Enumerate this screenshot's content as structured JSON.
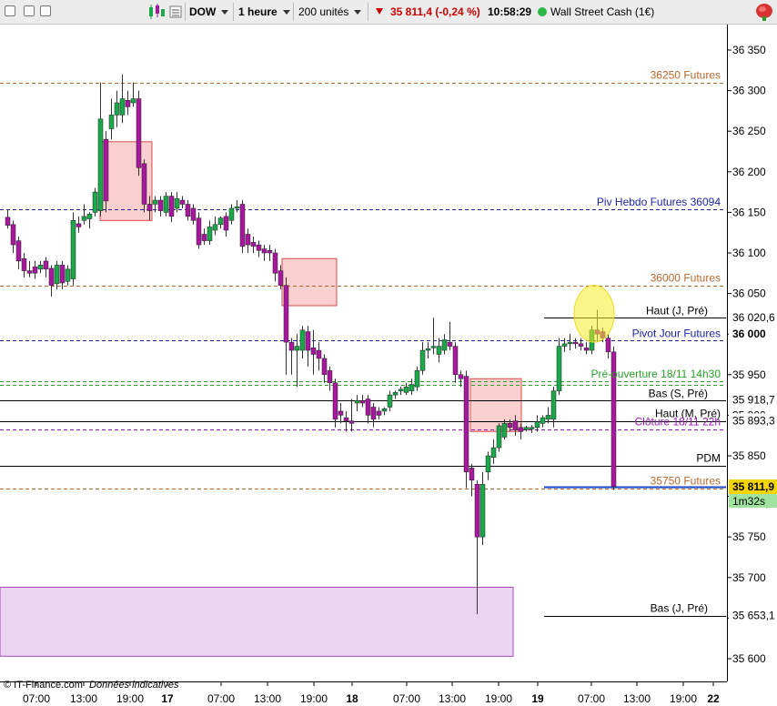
{
  "toolbar": {
    "symbol": "DOW",
    "timeframe": "1 heure",
    "units": "200 unités",
    "price": "35 811,4 (-0,24 %)",
    "time": "10:58:29",
    "instrument": "Wall Street Cash (1€)",
    "icons": [
      "window-icon",
      "window-icon",
      "window-icon",
      "candles-icon",
      "menu-icon",
      "tree-icon"
    ]
  },
  "footer": {
    "credit": "© IT-Finance.com",
    "note": "Données indicatives"
  },
  "colors": {
    "up": "#1aa84a",
    "down": "#a8189e",
    "futures": "#b8682c",
    "pivot": "#1c24a0",
    "preopen": "#28a028",
    "close": "#9a1ab8",
    "last_bg": "#f5d400",
    "timer_bg": "#9fe39f"
  },
  "chart_data": {
    "type": "candlestick",
    "y_ticks": [
      "36 350",
      "36 300",
      "36 250",
      "36 200",
      "36 150",
      "36 100",
      "36 050",
      "36 000",
      "35 950",
      "35 900",
      "35 850",
      "35 800",
      "35 750",
      "35 700",
      "35 650",
      "35 600"
    ],
    "ylim": [
      35585,
      36375
    ],
    "x_ticks": [
      {
        "label": "07:00",
        "x": 40
      },
      {
        "label": "13:00",
        "x": 92
      },
      {
        "label": "19:00",
        "x": 143
      },
      {
        "label": "17",
        "x": 184,
        "bold": true
      },
      {
        "label": "07:00",
        "x": 243
      },
      {
        "label": "13:00",
        "x": 294
      },
      {
        "label": "19:00",
        "x": 345
      },
      {
        "label": "18",
        "x": 387,
        "bold": true
      },
      {
        "label": "07:00",
        "x": 447
      },
      {
        "label": "13:00",
        "x": 497
      },
      {
        "label": "19:00",
        "x": 548
      },
      {
        "label": "19",
        "x": 591,
        "bold": true
      },
      {
        "label": "07:00",
        "x": 650
      },
      {
        "label": "13:00",
        "x": 700
      },
      {
        "label": "19:00",
        "x": 751
      },
      {
        "label": "22",
        "x": 784,
        "bold": true
      }
    ],
    "candles": [
      {
        "x": 8,
        "o": 36144,
        "h": 36153,
        "c": 36134,
        "l": 36130
      },
      {
        "x": 14,
        "o": 36135,
        "h": 36140,
        "c": 36110,
        "l": 36100
      },
      {
        "x": 20,
        "o": 36115,
        "h": 36120,
        "c": 36090,
        "l": 36080
      },
      {
        "x": 26,
        "o": 36093,
        "h": 36100,
        "c": 36078,
        "l": 36070
      },
      {
        "x": 32,
        "o": 36078,
        "h": 36090,
        "c": 36075,
        "l": 36070
      },
      {
        "x": 38,
        "o": 36083,
        "h": 36090,
        "c": 36075,
        "l": 36068
      },
      {
        "x": 44,
        "o": 36080,
        "h": 36090,
        "c": 36085,
        "l": 36075
      },
      {
        "x": 50,
        "o": 36090,
        "h": 36095,
        "c": 36080,
        "l": 36070
      },
      {
        "x": 56,
        "o": 36081,
        "h": 36085,
        "c": 36060,
        "l": 36046
      },
      {
        "x": 62,
        "o": 36062,
        "h": 36090,
        "c": 36085,
        "l": 36055
      },
      {
        "x": 68,
        "o": 36085,
        "h": 36090,
        "c": 36063,
        "l": 36055
      },
      {
        "x": 74,
        "o": 36065,
        "h": 36085,
        "c": 36080,
        "l": 36060
      },
      {
        "x": 80,
        "o": 36068,
        "h": 36150,
        "c": 36140,
        "l": 36060
      },
      {
        "x": 86,
        "o": 36136,
        "h": 36145,
        "c": 36132,
        "l": 36125
      },
      {
        "x": 92,
        "o": 36140,
        "h": 36160,
        "c": 36145,
        "l": 36135
      },
      {
        "x": 98,
        "o": 36142,
        "h": 36150,
        "c": 36148,
        "l": 36130
      },
      {
        "x": 104,
        "o": 36150,
        "h": 36180,
        "c": 36175,
        "l": 36145
      },
      {
        "x": 110,
        "o": 36152,
        "h": 36310,
        "c": 36265,
        "l": 36145
      },
      {
        "x": 116,
        "o": 36240,
        "h": 36250,
        "c": 36164,
        "l": 36150
      },
      {
        "x": 122,
        "o": 36253,
        "h": 36290,
        "c": 36270,
        "l": 36240
      },
      {
        "x": 128,
        "o": 36270,
        "h": 36300,
        "c": 36285,
        "l": 36255
      },
      {
        "x": 134,
        "o": 36270,
        "h": 36320,
        "c": 36290,
        "l": 36260
      },
      {
        "x": 140,
        "o": 36288,
        "h": 36300,
        "c": 36280,
        "l": 36270
      },
      {
        "x": 146,
        "o": 36285,
        "h": 36310,
        "c": 36290,
        "l": 36280
      },
      {
        "x": 152,
        "o": 36290,
        "h": 36300,
        "c": 36205,
        "l": 36195
      },
      {
        "x": 158,
        "o": 36210,
        "h": 36215,
        "c": 36160,
        "l": 36150
      },
      {
        "x": 164,
        "o": 36160,
        "h": 36170,
        "c": 36152,
        "l": 36140
      },
      {
        "x": 170,
        "o": 36160,
        "h": 36170,
        "c": 36165,
        "l": 36150
      },
      {
        "x": 176,
        "o": 36165,
        "h": 36170,
        "c": 36152,
        "l": 36145
      },
      {
        "x": 182,
        "o": 36150,
        "h": 36175,
        "c": 36170,
        "l": 36145
      },
      {
        "x": 188,
        "o": 36170,
        "h": 36175,
        "c": 36145,
        "l": 36138
      },
      {
        "x": 194,
        "o": 36155,
        "h": 36175,
        "c": 36167,
        "l": 36150
      },
      {
        "x": 200,
        "o": 36165,
        "h": 36170,
        "c": 36160,
        "l": 36155
      },
      {
        "x": 206,
        "o": 36160,
        "h": 36165,
        "c": 36145,
        "l": 36140
      },
      {
        "x": 212,
        "o": 36155,
        "h": 36160,
        "c": 36140,
        "l": 36135
      },
      {
        "x": 218,
        "o": 36143,
        "h": 36150,
        "c": 36110,
        "l": 36105
      },
      {
        "x": 224,
        "o": 36123,
        "h": 36130,
        "c": 36115,
        "l": 36110
      },
      {
        "x": 230,
        "o": 36115,
        "h": 36140,
        "c": 36132,
        "l": 36110
      },
      {
        "x": 236,
        "o": 36128,
        "h": 36145,
        "c": 36135,
        "l": 36122
      },
      {
        "x": 242,
        "o": 36135,
        "h": 36145,
        "c": 36143,
        "l": 36130
      },
      {
        "x": 248,
        "o": 36145,
        "h": 36150,
        "c": 36128,
        "l": 36120
      },
      {
        "x": 254,
        "o": 36140,
        "h": 36160,
        "c": 36155,
        "l": 36135
      },
      {
        "x": 260,
        "o": 36155,
        "h": 36165,
        "c": 36157,
        "l": 36150
      },
      {
        "x": 266,
        "o": 36160,
        "h": 36165,
        "c": 36108,
        "l": 36100
      },
      {
        "x": 272,
        "o": 36123,
        "h": 36130,
        "c": 36110,
        "l": 36100
      },
      {
        "x": 278,
        "o": 36113,
        "h": 36120,
        "c": 36108,
        "l": 36100
      },
      {
        "x": 284,
        "o": 36110,
        "h": 36115,
        "c": 36103,
        "l": 36095
      },
      {
        "x": 290,
        "o": 36105,
        "h": 36110,
        "c": 36100,
        "l": 36090
      },
      {
        "x": 296,
        "o": 36103,
        "h": 36110,
        "c": 36100,
        "l": 36090
      },
      {
        "x": 302,
        "o": 36100,
        "h": 36105,
        "c": 36075,
        "l": 36065
      },
      {
        "x": 308,
        "o": 36078,
        "h": 36085,
        "c": 36060,
        "l": 36055
      },
      {
        "x": 314,
        "o": 36060,
        "h": 36070,
        "c": 35990,
        "l": 35950
      },
      {
        "x": 320,
        "o": 35990,
        "h": 35995,
        "c": 35980,
        "l": 35950
      },
      {
        "x": 326,
        "o": 35980,
        "h": 36000,
        "c": 35985,
        "l": 35935
      },
      {
        "x": 332,
        "o": 35980,
        "h": 36010,
        "c": 36005,
        "l": 35970
      },
      {
        "x": 338,
        "o": 36003,
        "h": 36010,
        "c": 35980,
        "l": 35960
      },
      {
        "x": 344,
        "o": 35983,
        "h": 36005,
        "c": 35975,
        "l": 35950
      },
      {
        "x": 350,
        "o": 35980,
        "h": 35990,
        "c": 35970,
        "l": 35955
      },
      {
        "x": 356,
        "o": 35970,
        "h": 35975,
        "c": 35950,
        "l": 35940
      },
      {
        "x": 362,
        "o": 35955,
        "h": 35960,
        "c": 35940,
        "l": 35930
      },
      {
        "x": 368,
        "o": 35940,
        "h": 35945,
        "c": 35895,
        "l": 35885
      },
      {
        "x": 374,
        "o": 35905,
        "h": 35915,
        "c": 35900,
        "l": 35890
      },
      {
        "x": 380,
        "o": 35897,
        "h": 35905,
        "c": 35893,
        "l": 35880
      },
      {
        "x": 386,
        "o": 35893,
        "h": 35920,
        "c": 35890,
        "l": 35880
      },
      {
        "x": 392,
        "o": 35915,
        "h": 35925,
        "c": 35918,
        "l": 35905
      },
      {
        "x": 398,
        "o": 35918,
        "h": 35925,
        "c": 35915,
        "l": 35910
      },
      {
        "x": 404,
        "o": 35920,
        "h": 35925,
        "c": 35900,
        "l": 35890
      },
      {
        "x": 410,
        "o": 35910,
        "h": 35915,
        "c": 35895,
        "l": 35885
      },
      {
        "x": 416,
        "o": 35905,
        "h": 35910,
        "c": 35900,
        "l": 35895
      },
      {
        "x": 422,
        "o": 35905,
        "h": 35910,
        "c": 35908,
        "l": 35900
      },
      {
        "x": 428,
        "o": 35910,
        "h": 35930,
        "c": 35925,
        "l": 35905
      },
      {
        "x": 434,
        "o": 35925,
        "h": 35930,
        "c": 35928,
        "l": 35920
      },
      {
        "x": 440,
        "o": 35930,
        "h": 35935,
        "c": 35932,
        "l": 35925
      },
      {
        "x": 446,
        "o": 35928,
        "h": 35940,
        "c": 35935,
        "l": 35925
      },
      {
        "x": 452,
        "o": 35930,
        "h": 35945,
        "c": 35938,
        "l": 35925
      },
      {
        "x": 458,
        "o": 35935,
        "h": 35960,
        "c": 35955,
        "l": 35930
      },
      {
        "x": 464,
        "o": 35955,
        "h": 35990,
        "c": 35980,
        "l": 35950
      },
      {
        "x": 470,
        "o": 35980,
        "h": 35990,
        "c": 35982,
        "l": 35970
      },
      {
        "x": 476,
        "o": 35983,
        "h": 36020,
        "c": 35985,
        "l": 35975
      },
      {
        "x": 482,
        "o": 35975,
        "h": 35995,
        "c": 35985,
        "l": 35965
      },
      {
        "x": 488,
        "o": 35980,
        "h": 36000,
        "c": 35993,
        "l": 35975
      },
      {
        "x": 494,
        "o": 35990,
        "h": 36015,
        "c": 35985,
        "l": 35980
      },
      {
        "x": 500,
        "o": 35985,
        "h": 35990,
        "c": 35950,
        "l": 35940
      },
      {
        "x": 506,
        "o": 35950,
        "h": 35955,
        "c": 35945,
        "l": 35935
      },
      {
        "x": 512,
        "o": 35948,
        "h": 35955,
        "c": 35830,
        "l": 35810
      },
      {
        "x": 518,
        "o": 35835,
        "h": 35840,
        "c": 35820,
        "l": 35800
      },
      {
        "x": 524,
        "o": 35815,
        "h": 35820,
        "c": 35750,
        "l": 35655
      },
      {
        "x": 530,
        "o": 35750,
        "h": 35830,
        "c": 35815,
        "l": 35740
      },
      {
        "x": 536,
        "o": 35830,
        "h": 35855,
        "c": 35850,
        "l": 35820
      },
      {
        "x": 542,
        "o": 35848,
        "h": 35870,
        "c": 35860,
        "l": 35840
      },
      {
        "x": 548,
        "o": 35860,
        "h": 35890,
        "c": 35887,
        "l": 35855
      },
      {
        "x": 554,
        "o": 35873,
        "h": 35895,
        "c": 35890,
        "l": 35870
      },
      {
        "x": 560,
        "o": 35890,
        "h": 35895,
        "c": 35885,
        "l": 35880
      },
      {
        "x": 566,
        "o": 35893,
        "h": 35900,
        "c": 35882,
        "l": 35875
      },
      {
        "x": 572,
        "o": 35885,
        "h": 35890,
        "c": 35880,
        "l": 35870
      },
      {
        "x": 578,
        "o": 35882,
        "h": 35887,
        "c": 35885,
        "l": 35880
      },
      {
        "x": 584,
        "o": 35883,
        "h": 35888,
        "c": 35885,
        "l": 35878
      },
      {
        "x": 590,
        "o": 35885,
        "h": 35900,
        "c": 35892,
        "l": 35880
      },
      {
        "x": 596,
        "o": 35890,
        "h": 35900,
        "c": 35897,
        "l": 35885
      },
      {
        "x": 602,
        "o": 35895,
        "h": 35910,
        "c": 35900,
        "l": 35890
      },
      {
        "x": 608,
        "o": 35895,
        "h": 35935,
        "c": 35930,
        "l": 35885
      },
      {
        "x": 614,
        "o": 35930,
        "h": 35995,
        "c": 35985,
        "l": 35925
      },
      {
        "x": 620,
        "o": 35985,
        "h": 35995,
        "c": 35988,
        "l": 35978
      },
      {
        "x": 626,
        "o": 35988,
        "h": 36000,
        "c": 35990,
        "l": 35980
      },
      {
        "x": 632,
        "o": 35990,
        "h": 35995,
        "c": 35988,
        "l": 35982
      },
      {
        "x": 638,
        "o": 35988,
        "h": 35995,
        "c": 35985,
        "l": 35980
      },
      {
        "x": 644,
        "o": 35983,
        "h": 35990,
        "c": 35980,
        "l": 35975
      },
      {
        "x": 650,
        "o": 35980,
        "h": 36010,
        "c": 36005,
        "l": 35975
      },
      {
        "x": 656,
        "o": 36005,
        "h": 36030,
        "c": 36000,
        "l": 35990
      },
      {
        "x": 662,
        "o": 36003,
        "h": 36008,
        "c": 35995,
        "l": 35990
      },
      {
        "x": 668,
        "o": 35995,
        "h": 36000,
        "c": 35978,
        "l": 35970
      },
      {
        "x": 674,
        "o": 35978,
        "h": 35985,
        "c": 35812,
        "l": 35808
      }
    ],
    "hlines": [
      {
        "value": 36310,
        "style": "dash",
        "color": "#b8682c",
        "label": "36250 Futures",
        "xlabel": 792
      },
      {
        "value": 36154,
        "style": "dash",
        "color": "#1c24a0",
        "label": "Piv Hebdo Futures 36094",
        "xlabel": 792
      },
      {
        "value": 36060,
        "style": "dash",
        "color": "#b8682c",
        "label": "36000 Futures",
        "xlabel": 792
      },
      {
        "value": 35992,
        "style": "dash",
        "color": "#1c24a0",
        "label": "Pivot Jour Futures",
        "xlabel": 792
      },
      {
        "value": 35942,
        "style": "dash",
        "color": "#28a028",
        "label": "Pré-ouverture 18/11 14h30",
        "xlabel": 792
      },
      {
        "value": 35937,
        "style": "dash",
        "color": "#28a028",
        "label": "",
        "xlabel": 792
      },
      {
        "value": 35918,
        "style": "solid",
        "color": "#000000",
        "label": "Bas (S, Pré)",
        "xlabel": 778
      },
      {
        "value": 35893,
        "style": "solid",
        "color": "#000000",
        "label": "Haut (M, Pré)",
        "xlabel": 792
      },
      {
        "value": 35883,
        "style": "dash",
        "color": "#9a1ab8",
        "label": "Clôture 18/11 22h",
        "xlabel": 792
      },
      {
        "value": 35838,
        "style": "solid",
        "color": "#000000",
        "label": "PDM",
        "xlabel": 792
      },
      {
        "value": 35810,
        "style": "dash",
        "color": "#b8682c",
        "label": "35750 Futures",
        "xlabel": 792
      }
    ],
    "short_lines": [
      {
        "value": 36020,
        "label": "Haut (J, Pré)",
        "xlabel": 778
      },
      {
        "value": 35653,
        "label": "Bas (J, Pré)",
        "xlabel": 778
      }
    ],
    "current_price_line": 35812,
    "zones": [
      {
        "x1": 110,
        "x2": 167,
        "hi": 36237,
        "lo": 36140,
        "color": "red"
      },
      {
        "x1": 310,
        "x2": 370,
        "hi": 36093,
        "lo": 36035,
        "color": "red"
      },
      {
        "x1": 517,
        "x2": 573,
        "hi": 35945,
        "lo": 35880,
        "color": "red"
      },
      {
        "x1": 0,
        "x2": 564,
        "hi": 35688,
        "lo": 35603,
        "color": "purple"
      }
    ],
    "highlight_ellipse": {
      "cx": 653,
      "value": 36025,
      "rx": 22,
      "ry_value": 35
    },
    "price_badges": [
      {
        "value": 36020.6,
        "text": "36 020,6",
        "bold": false,
        "bg": "#fff"
      },
      {
        "value": 35918.7,
        "text": "35 918,7",
        "bold": false,
        "bg": "#fff"
      },
      {
        "value": 35893.3,
        "text": "35 893,3",
        "bold": false,
        "bg": "#fff"
      },
      {
        "value": 35653.1,
        "text": "35 653,1",
        "bold": false,
        "bg": "#fff"
      },
      {
        "value": 36000,
        "text": "36 000",
        "bold": true,
        "bg": "#fff"
      }
    ],
    "last_price": {
      "value": 35811.9,
      "text": "35 811,9"
    },
    "timer": "1m32s",
    "hidden_badge_text": "35 811,9"
  }
}
